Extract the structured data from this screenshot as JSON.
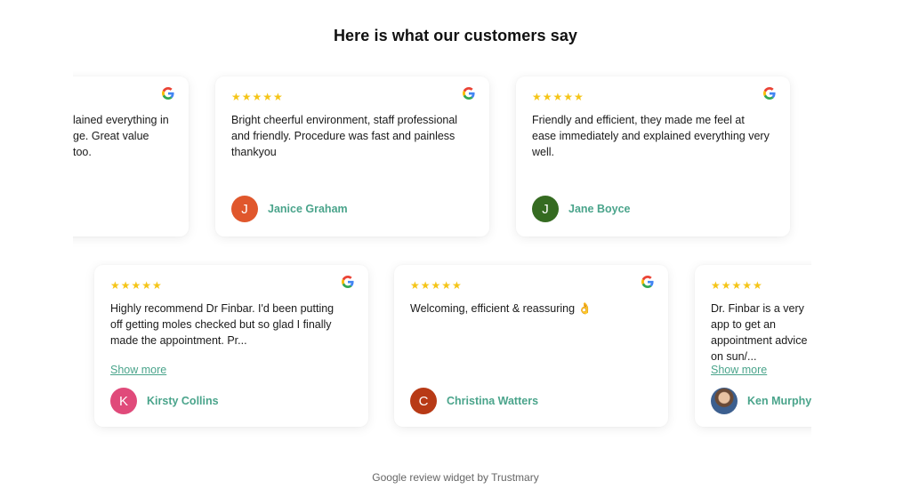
{
  "page": {
    "title": "Here is what our customers say"
  },
  "rows": [
    {
      "reviews": [
        {
          "stars": "★★★★★",
          "text": "lained everything in ge. Great value too.",
          "author": "",
          "initial": "",
          "avatar_color": ""
        },
        {
          "stars": "★★★★★",
          "text": "Bright cheerful environment, staff professional and friendly. Procedure was fast and painless thankyou",
          "author": "Janice Graham",
          "initial": "J",
          "avatar_color": "#e0572c"
        },
        {
          "stars": "★★★★★",
          "text": "Friendly and efficient, they made me feel at ease immediately and explained everything very well.",
          "author": "Jane Boyce",
          "initial": "J",
          "avatar_color": "#356b21"
        }
      ]
    },
    {
      "reviews": [
        {
          "stars": "★★★★★",
          "text": "Highly recommend Dr Finbar. I'd been putting off getting moles checked but so glad I finally made the appointment. Pr...",
          "show_more": "Show more",
          "author": "Kirsty Collins",
          "initial": "K",
          "avatar_color": "#e04a7a"
        },
        {
          "stars": "★★★★★",
          "text": "Welcoming, efficient & reassuring 👌",
          "author": "Christina Watters",
          "initial": "C",
          "avatar_color": "#b83a16"
        },
        {
          "stars": "★★★★★",
          "text": "Dr. Finbar is a very app to get an appointment advice on sun/...",
          "show_more": "Show more",
          "author": "Ken Murphy",
          "initial": "",
          "avatar_color": ""
        }
      ]
    }
  ],
  "footer": {
    "text": "Google review widget by Trustmary"
  },
  "colors": {
    "accent": "#4aa48b",
    "star": "#f5c518"
  },
  "icons": {
    "review_source": "google-icon"
  }
}
